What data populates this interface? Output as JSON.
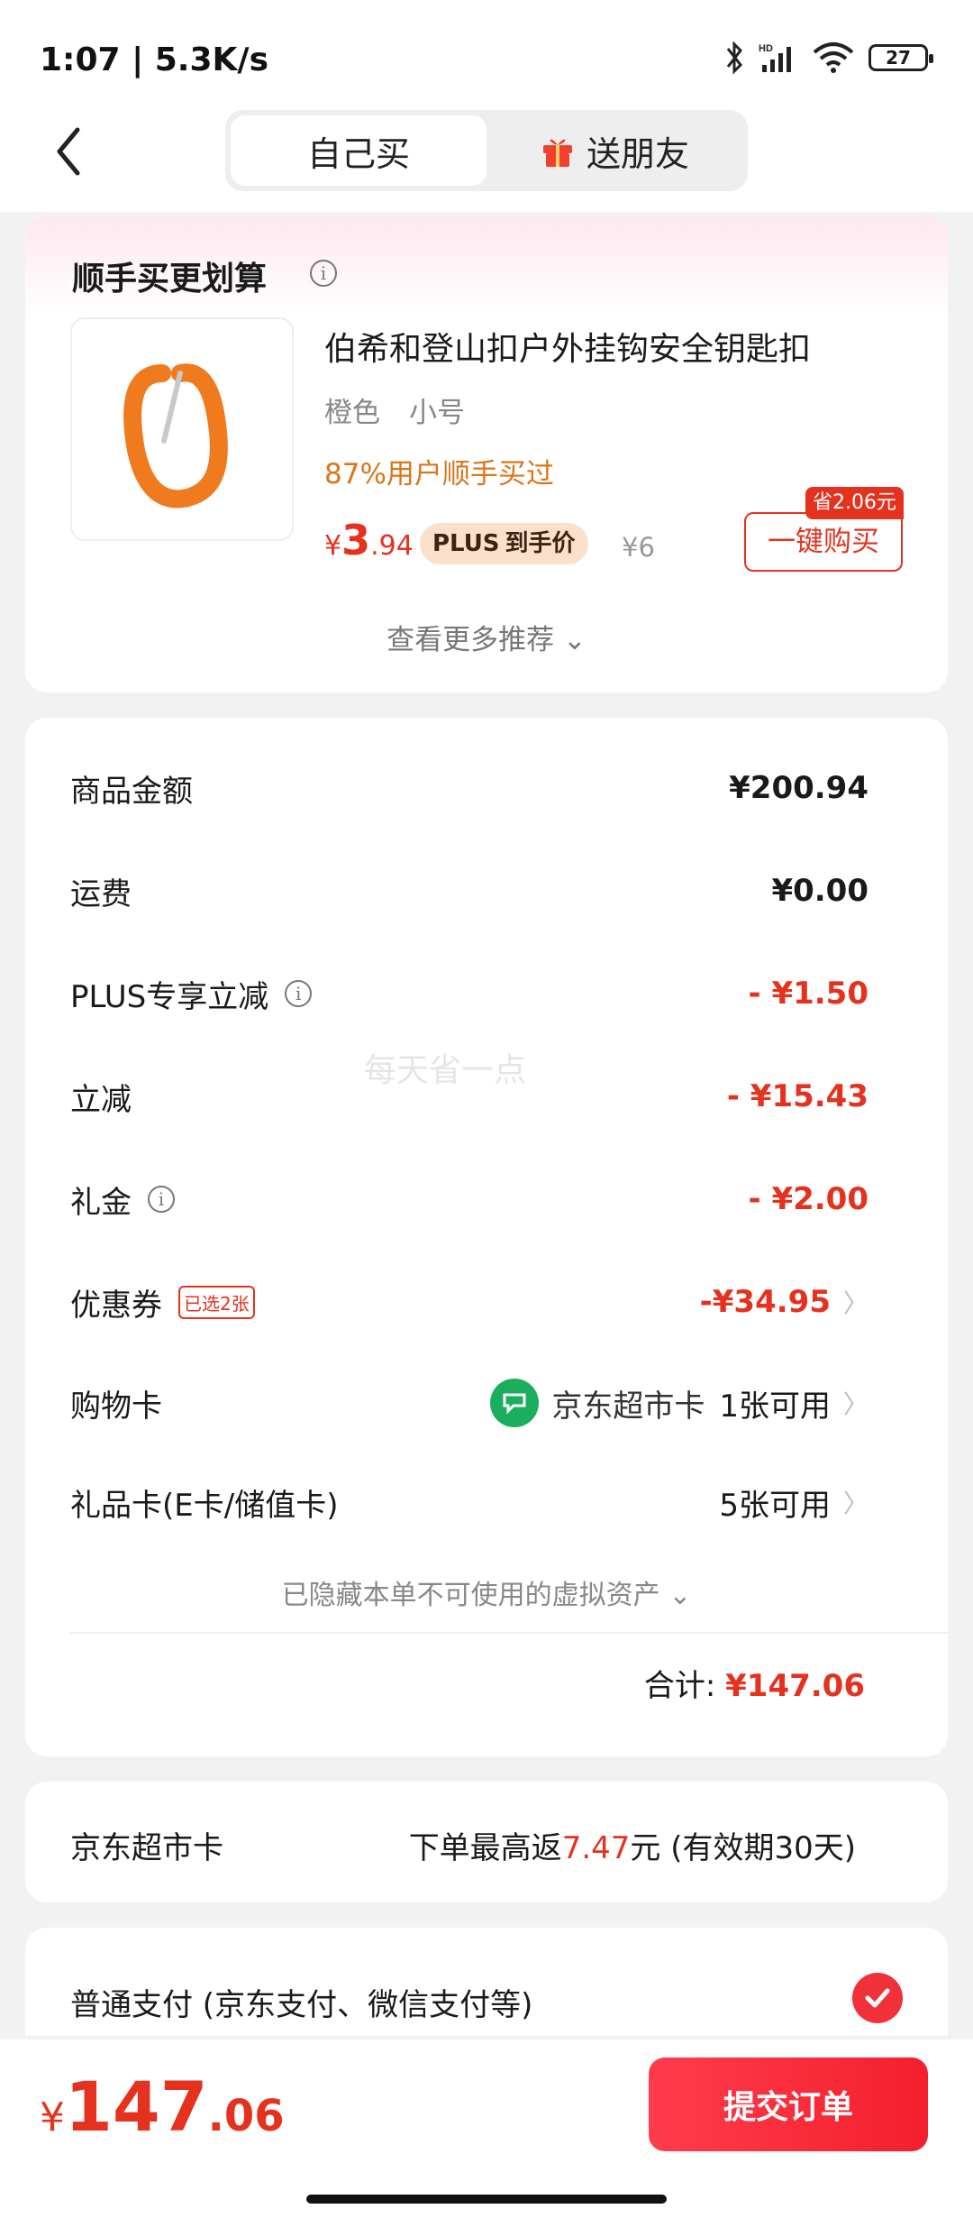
{
  "status_bar": {
    "time": "1:07 | 5.3K/s",
    "battery": "27"
  },
  "nav": {
    "tabs": [
      {
        "label": "自己买",
        "active": true
      },
      {
        "label": "送朋友",
        "active": false
      }
    ]
  },
  "recommend": {
    "title": "顺手买更划算",
    "product": {
      "name": "伯希和登山扣户外挂钩安全钥匙扣",
      "color": "橙色",
      "size": "小号",
      "hint": "87%用户顺手买过",
      "price_yen": "¥",
      "price_int": "3",
      "price_dec": ".94",
      "plus_label": "PLUS",
      "plus_suffix": "到手价",
      "orig_price": "¥6",
      "save_tag": "省2.06元",
      "buy_label": "一键购买"
    },
    "more": "查看更多推荐 ⌄"
  },
  "summary": {
    "rows": [
      {
        "label": "商品金额",
        "value": "¥200.94"
      },
      {
        "label": "运费",
        "value": "¥0.00"
      },
      {
        "label": "PLUS专享立减",
        "value": "- ¥1.50"
      },
      {
        "label": "立减",
        "value": "- ¥15.43"
      },
      {
        "label": "礼金",
        "value": "- ¥2.00"
      },
      {
        "label": "优惠券",
        "badge": "已选2张",
        "value": "-¥34.95"
      },
      {
        "label": "购物卡",
        "card_name": "京东超市卡",
        "value": "1张可用"
      },
      {
        "label": "礼品卡(E卡/储值卡)",
        "value": "5张可用"
      }
    ],
    "watermark": "每天省一点",
    "hidden_note": "已隐藏本单不可使用的虚拟资产 ⌄",
    "total_label": "合计: ",
    "total_value": "¥147.06"
  },
  "jd_card": {
    "label": "京东超市卡",
    "prefix": "下单最高返",
    "amount": "7.47",
    "suffix": "元 (有效期30天)"
  },
  "payment": {
    "label": "普通支付 (京东支付、微信支付等)"
  },
  "bottom": {
    "yen": "¥",
    "int": "147",
    "dec": ".06",
    "submit": "提交订单"
  },
  "colors": {
    "accent": "#e4321f",
    "orange_hint": "#d9761a",
    "jd_green": "#1bae5d"
  }
}
